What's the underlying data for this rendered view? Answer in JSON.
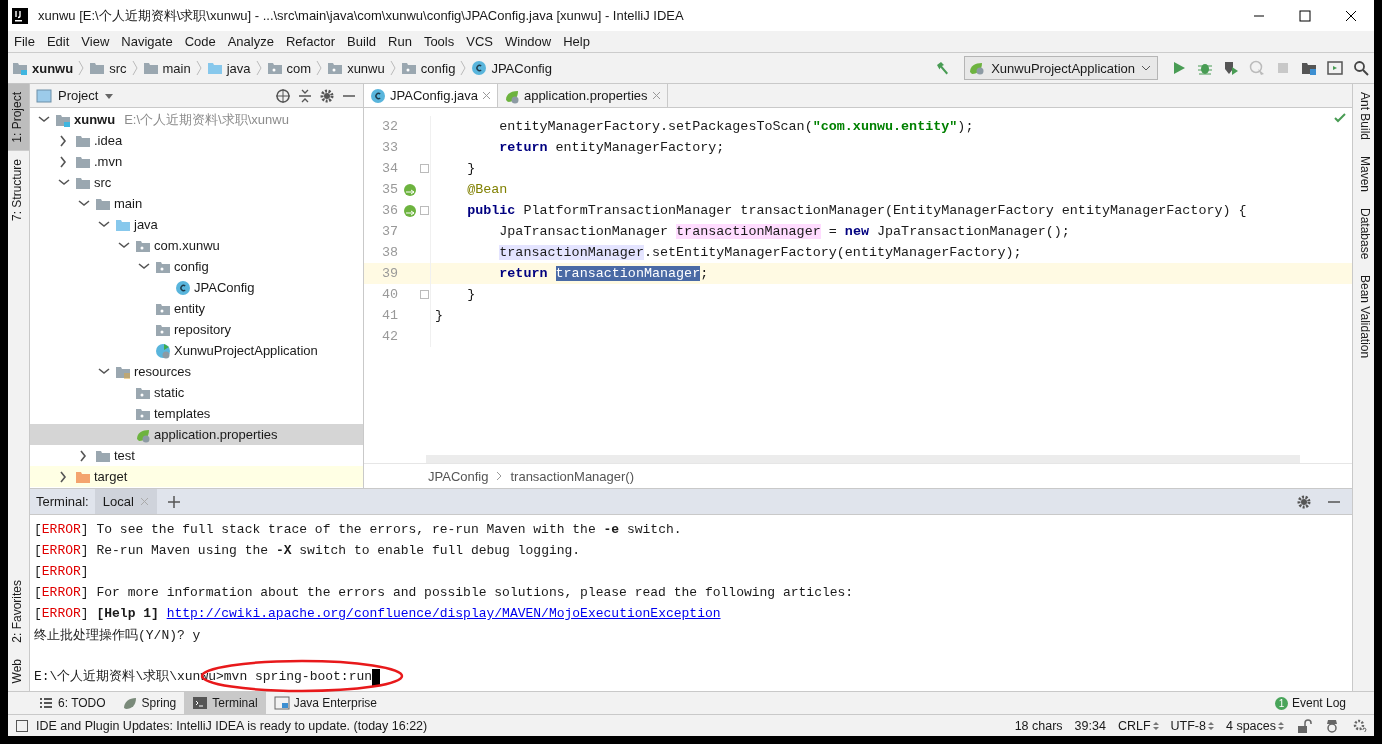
{
  "window": {
    "title": "xunwu [E:\\个人近期资料\\求职\\xunwu] - ...\\src\\main\\java\\com\\xunwu\\config\\JPAConfig.java [xunwu] - IntelliJ IDEA"
  },
  "menu": [
    "File",
    "Edit",
    "View",
    "Navigate",
    "Code",
    "Analyze",
    "Refactor",
    "Build",
    "Run",
    "Tools",
    "VCS",
    "Window",
    "Help"
  ],
  "navbar": {
    "breadcrumbs": [
      {
        "label": "xunwu",
        "kind": "module"
      },
      {
        "label": "src",
        "kind": "folder"
      },
      {
        "label": "main",
        "kind": "folder"
      },
      {
        "label": "java",
        "kind": "source-folder"
      },
      {
        "label": "com",
        "kind": "package"
      },
      {
        "label": "xunwu",
        "kind": "package"
      },
      {
        "label": "config",
        "kind": "package"
      },
      {
        "label": "JPAConfig",
        "kind": "class"
      }
    ],
    "run_config": "XunwuProjectApplication"
  },
  "left_tools_top": [
    {
      "label": "1: Project",
      "selected": true
    },
    {
      "label": "7: Structure",
      "selected": false
    }
  ],
  "left_tools_bottom": [
    {
      "label": "2: Favorites",
      "selected": false
    },
    {
      "label": "Web",
      "selected": false
    }
  ],
  "right_tools": [
    "Ant Build",
    "Maven",
    "Database",
    "Bean Validation"
  ],
  "project_panel": {
    "title": "Project",
    "tree": [
      {
        "label": "xunwu",
        "path": "E:\\个人近期资料\\求职\\xunwu",
        "kind": "module",
        "expanded": true,
        "selected": false,
        "excluded": false,
        "children": [
          {
            "label": ".idea",
            "kind": "folder",
            "expanded": false,
            "selected": false,
            "excluded": false
          },
          {
            "label": ".mvn",
            "kind": "folder",
            "expanded": false,
            "selected": false,
            "excluded": false
          },
          {
            "label": "src",
            "kind": "folder",
            "expanded": true,
            "selected": false,
            "excluded": false,
            "children": [
              {
                "label": "main",
                "kind": "folder",
                "expanded": true,
                "selected": false,
                "excluded": false,
                "children": [
                  {
                    "label": "java",
                    "kind": "source-folder",
                    "expanded": true,
                    "selected": false,
                    "excluded": false,
                    "children": [
                      {
                        "label": "com.xunwu",
                        "kind": "package",
                        "expanded": true,
                        "selected": false,
                        "excluded": false,
                        "children": [
                          {
                            "label": "config",
                            "kind": "package",
                            "expanded": true,
                            "selected": false,
                            "excluded": false,
                            "children": [
                              {
                                "label": "JPAConfig",
                                "kind": "class",
                                "selected": false,
                                "excluded": false
                              }
                            ]
                          },
                          {
                            "label": "entity",
                            "kind": "package",
                            "selected": false,
                            "excluded": false
                          },
                          {
                            "label": "repository",
                            "kind": "package",
                            "selected": false,
                            "excluded": false
                          },
                          {
                            "label": "XunwuProjectApplication",
                            "kind": "spring-class",
                            "selected": false,
                            "excluded": false
                          }
                        ]
                      }
                    ]
                  },
                  {
                    "label": "resources",
                    "kind": "resources",
                    "expanded": true,
                    "selected": false,
                    "excluded": false,
                    "children": [
                      {
                        "label": "static",
                        "kind": "package",
                        "selected": false,
                        "excluded": false
                      },
                      {
                        "label": "templates",
                        "kind": "package",
                        "selected": false,
                        "excluded": false
                      },
                      {
                        "label": "application.properties",
                        "kind": "spring-properties",
                        "selected": true,
                        "excluded": false
                      }
                    ]
                  }
                ]
              },
              {
                "label": "test",
                "kind": "folder",
                "expanded": false,
                "selected": false,
                "excluded": false
              }
            ]
          },
          {
            "label": "target",
            "kind": "excluded-folder",
            "expanded": false,
            "selected": false,
            "excluded": true
          }
        ]
      }
    ]
  },
  "editor": {
    "tabs": [
      {
        "label": "JPAConfig.java",
        "kind": "class",
        "selected": true
      },
      {
        "label": "application.properties",
        "kind": "spring-properties",
        "selected": false
      }
    ],
    "lines": [
      {
        "children": [
          {
            "children": [
              {
                "number": "32",
                "bean_marker": false,
                "fold": false,
                "current": false,
                "segments": [
                  {
                    "text": "entityManagerFactory.setPackagesToScan(",
                    "kind": "plain"
                  },
                  {
                    "text": "\"com.xunwu.entity\"",
                    "kind": "string"
                  },
                  {
                    "text": ");",
                    "kind": "plain"
                  }
                ]
              },
              {
                "number": "33",
                "bean_marker": false,
                "fold": false,
                "current": false,
                "segments": [
                  {
                    "text": "return",
                    "kind": "keyword"
                  },
                  {
                    "text": " entityManagerFactory;",
                    "kind": "plain"
                  }
                ]
              }
            ]
          },
          {
            "number": "34",
            "bean_marker": false,
            "fold": true,
            "current": false,
            "segments": [
              {
                "text": "}",
                "kind": "plain"
              }
            ]
          },
          {
            "number": "35",
            "bean_marker": true,
            "fold": false,
            "current": false,
            "segments": [
              {
                "text": "@Bean",
                "kind": "annotation"
              }
            ]
          },
          {
            "number": "36",
            "bean_marker": true,
            "fold": true,
            "current": false,
            "segments": [
              {
                "text": "public",
                "kind": "keyword"
              },
              {
                "text": " PlatformTransactionManager transactionManager(EntityManagerFactory entityManagerFactory) {",
                "kind": "plain"
              }
            ]
          },
          {
            "children": [
              {
                "number": "37",
                "bean_marker": false,
                "fold": false,
                "current": false,
                "segments": [
                  {
                    "text": "JpaTransactionManager ",
                    "kind": "plain"
                  },
                  {
                    "text": "transactionManager",
                    "kind": "write-usage"
                  },
                  {
                    "text": " = ",
                    "kind": "plain"
                  },
                  {
                    "text": "new",
                    "kind": "keyword"
                  },
                  {
                    "text": " JpaTransactionManager();",
                    "kind": "plain"
                  }
                ]
              },
              {
                "number": "38",
                "bean_marker": false,
                "fold": false,
                "current": false,
                "segments": [
                  {
                    "text": "transactionManager",
                    "kind": "read-usage"
                  },
                  {
                    "text": ".setEntityManagerFactory(entityManagerFactory);",
                    "kind": "plain"
                  }
                ]
              },
              {
                "number": "39",
                "bean_marker": false,
                "fold": false,
                "current": true,
                "segments": [
                  {
                    "text": "return ",
                    "kind": "keyword"
                  },
                  {
                    "text": "transactionManager",
                    "kind": "selection"
                  },
                  {
                    "text": ";",
                    "kind": "plain"
                  }
                ]
              }
            ]
          },
          {
            "number": "40",
            "bean_marker": false,
            "fold": true,
            "current": false,
            "segments": [
              {
                "text": "}",
                "kind": "plain"
              }
            ]
          }
        ]
      },
      {
        "number": "41",
        "bean_marker": false,
        "fold": false,
        "current": false,
        "segments": [
          {
            "text": "}",
            "kind": "plain"
          }
        ]
      },
      {
        "number": "42",
        "bean_marker": false,
        "fold": false,
        "current": false
      }
    ],
    "breadcrumbs": [
      "JPAConfig",
      "transactionManager()"
    ]
  },
  "terminal": {
    "label": "Terminal:",
    "tabs": [
      {
        "label": "Local",
        "selected": true
      }
    ],
    "lines": [
      {
        "segments": [
          {
            "text": "[",
            "kind": "plain"
          },
          {
            "text": "ERROR",
            "kind": "error"
          },
          {
            "text": "] To see the full stack trace of the errors, re-run Maven with the ",
            "kind": "plain"
          },
          {
            "text": "-e",
            "kind": "bold"
          },
          {
            "text": " switch.",
            "kind": "plain"
          }
        ]
      },
      {
        "segments": [
          {
            "text": "[",
            "kind": "plain"
          },
          {
            "text": "ERROR",
            "kind": "error"
          },
          {
            "text": "] Re-run Maven using the ",
            "kind": "plain"
          },
          {
            "text": "-X",
            "kind": "bold"
          },
          {
            "text": " switch to enable full debug logging.",
            "kind": "plain"
          }
        ]
      },
      {
        "segments": [
          {
            "text": "[",
            "kind": "plain"
          },
          {
            "text": "ERROR",
            "kind": "error"
          },
          {
            "text": "]",
            "kind": "plain"
          }
        ]
      },
      {
        "segments": [
          {
            "text": "[",
            "kind": "plain"
          },
          {
            "text": "ERROR",
            "kind": "error"
          },
          {
            "text": "] For more information about the errors and possible solutions, please read the following articles:",
            "kind": "plain"
          }
        ]
      },
      {
        "segments": [
          {
            "text": "[",
            "kind": "plain"
          },
          {
            "text": "ERROR",
            "kind": "error"
          },
          {
            "text": "] ",
            "kind": "plain"
          },
          {
            "text": "[Help 1] ",
            "kind": "bold"
          },
          {
            "text": "http://cwiki.apache.org/confluence/display/MAVEN/MojoExecutionException",
            "kind": "link"
          }
        ]
      },
      {
        "segments": [
          {
            "text": "终止批处理操作吗(Y/N)? y",
            "kind": "plain"
          }
        ]
      }
    ],
    "prompt": {
      "text": "E:\\个人近期资料\\求职\\xunwu>mvn spring-boot:run",
      "cursor": true,
      "circled": true
    }
  },
  "tool_tabs": [
    {
      "label": "6: TODO",
      "kind": "todo",
      "selected": false
    },
    {
      "label": "Spring",
      "kind": "spring",
      "selected": false
    },
    {
      "label": "Terminal",
      "kind": "terminal",
      "selected": true
    },
    {
      "label": "Java Enterprise",
      "kind": "enterprise",
      "selected": false
    }
  ],
  "event_log": {
    "label": "Event Log",
    "count": "1"
  },
  "status_bar": {
    "message": "IDE and Plugin Updates: IntelliJ IDEA is ready to update. (today 16:22)",
    "items": [
      {
        "label": "18 chars",
        "dropdown": false
      },
      {
        "label": "39:34",
        "dropdown": false
      },
      {
        "label": "CRLF",
        "dropdown": true
      },
      {
        "label": "UTF-8",
        "dropdown": true
      },
      {
        "label": "4 spaces",
        "dropdown": true
      }
    ]
  }
}
